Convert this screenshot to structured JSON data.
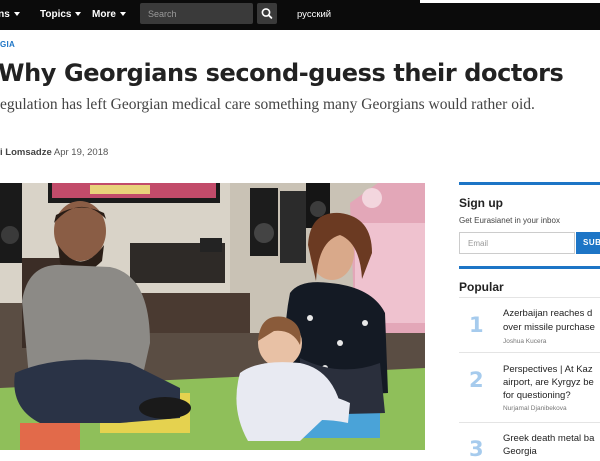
{
  "nav": {
    "items": [
      {
        "label": "ons"
      },
      {
        "label": "Topics"
      },
      {
        "label": "More"
      }
    ],
    "search_placeholder": "Search",
    "language": "русский"
  },
  "article": {
    "category": "GIA",
    "headline": "Why Georgians second-guess their doctors",
    "deck": "egulation has left Georgian medical care something many Georgians would rather oid.",
    "author": "i Lomsadze",
    "date": "Apr 19, 2018"
  },
  "sidebar": {
    "signup_title": "Sign up",
    "signup_sub": "Get Eurasianet in your inbox",
    "email_placeholder": "Email",
    "subscribe_label": "SUBSCRIBE",
    "popular_title": "Popular",
    "popular": [
      {
        "num": "1",
        "line1": "Azerbaijan reaches d",
        "line2": "over missile purchase",
        "author": "Joshua Kucera"
      },
      {
        "num": "2",
        "line1": "Perspectives | At Kaz",
        "line2": "airport, are Kyrgyz be",
        "line3": "for questioning?",
        "author": "Nurjamal Djanibekova"
      },
      {
        "num": "3",
        "line1": "Greek death metal ba",
        "line2": "Georgia"
      }
    ]
  },
  "colors": {
    "accent": "#1d75c6",
    "nav_bg": "#0b0b0b",
    "popular_number": "#a6cbed"
  }
}
